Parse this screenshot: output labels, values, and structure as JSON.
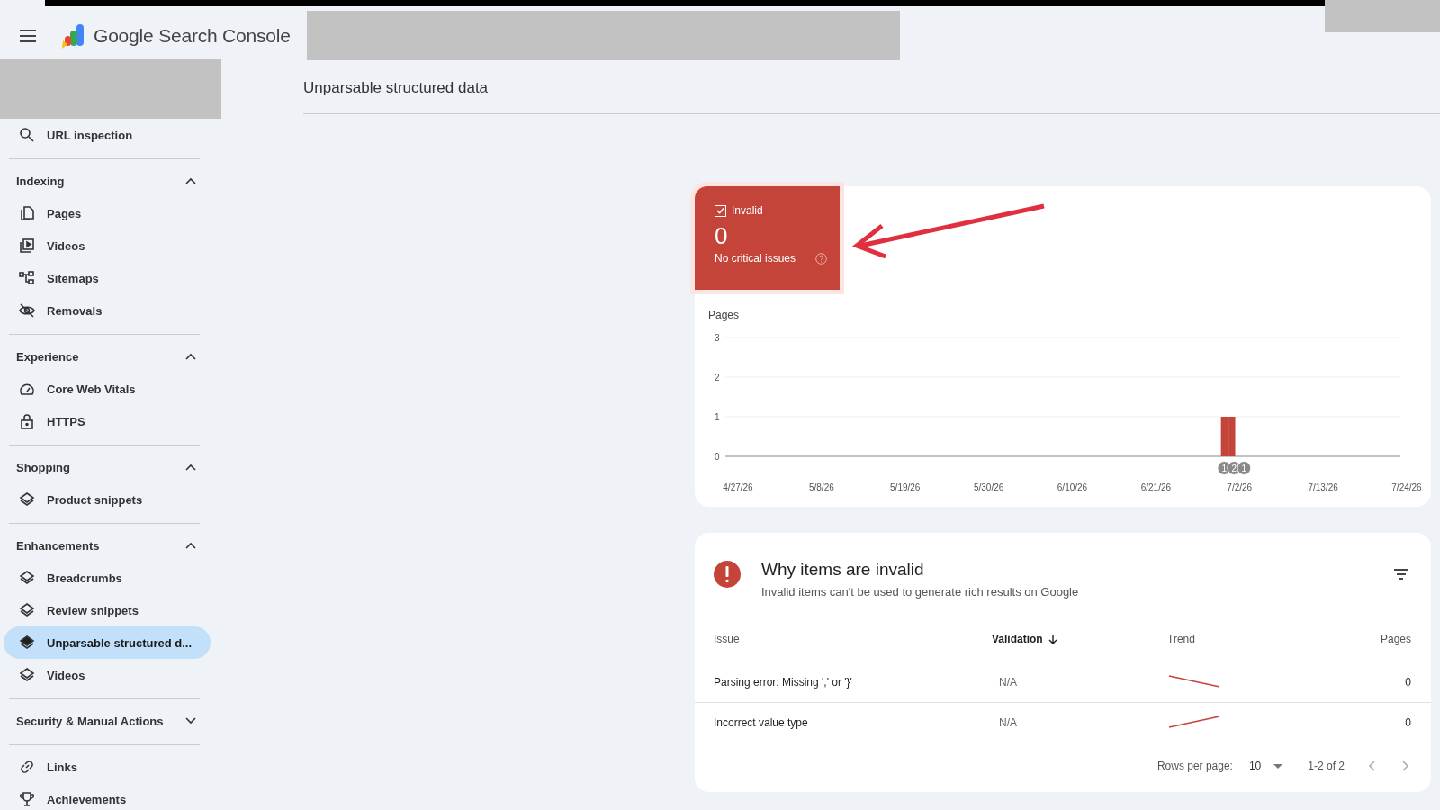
{
  "app": {
    "title": "Google Search Console"
  },
  "sidebar": {
    "groups": [
      {
        "items": [
          {
            "label": "URL inspection",
            "selected": false
          }
        ]
      },
      {
        "title": "Indexing",
        "expanded": true,
        "items": [
          {
            "label": "Pages",
            "selected": false
          },
          {
            "label": "Videos",
            "selected": false
          },
          {
            "label": "Sitemaps",
            "selected": false
          },
          {
            "label": "Removals",
            "selected": false
          }
        ]
      },
      {
        "title": "Experience",
        "expanded": true,
        "items": [
          {
            "label": "Core Web Vitals",
            "selected": false
          },
          {
            "label": "HTTPS",
            "selected": false
          }
        ]
      },
      {
        "title": "Shopping",
        "expanded": true,
        "items": [
          {
            "label": "Product snippets",
            "selected": false
          }
        ]
      },
      {
        "title": "Enhancements",
        "expanded": true,
        "items": [
          {
            "label": "Breadcrumbs",
            "selected": false
          },
          {
            "label": "Review snippets",
            "selected": false
          },
          {
            "label": "Unparsable structured d...",
            "selected": true
          },
          {
            "label": "Videos",
            "selected": false
          }
        ]
      },
      {
        "title": "Security & Manual Actions",
        "expanded": false
      },
      {
        "items": [
          {
            "label": "Links",
            "selected": false
          },
          {
            "label": "Achievements",
            "selected": false
          }
        ]
      }
    ]
  },
  "page": {
    "title": "Unparsable structured data"
  },
  "status_tile": {
    "label": "Invalid",
    "checked": true,
    "count": "0",
    "note": "No critical issues"
  },
  "chart": {
    "chart_data": {
      "type": "bar",
      "ylabel": "Pages",
      "categories": [
        "4/27/26",
        null,
        null,
        null,
        null,
        null,
        null,
        null,
        null,
        null,
        null,
        "5/8/26",
        null,
        null,
        null,
        null,
        null,
        null,
        null,
        null,
        null,
        null,
        "5/19/26",
        null,
        null,
        null,
        null,
        null,
        null,
        null,
        null,
        null,
        null,
        "5/30/26",
        null,
        null,
        null,
        null,
        null,
        null,
        null,
        null,
        null,
        null,
        "6/10/26",
        null,
        null,
        null,
        null,
        null,
        null,
        null,
        null,
        null,
        null,
        "6/21/26",
        null,
        null,
        null,
        null,
        null,
        null,
        null,
        null,
        null,
        null,
        "7/2/26",
        null,
        null,
        null,
        null,
        null,
        null,
        null,
        null,
        null,
        null,
        "7/13/26",
        null,
        null,
        null,
        null,
        null,
        null,
        null,
        null,
        null,
        null,
        "7/24/26"
      ],
      "series": [
        {
          "color": "#c5443a",
          "values": [
            null,
            null,
            null,
            null,
            null,
            null,
            null,
            null,
            null,
            null,
            null,
            null,
            null,
            null,
            null,
            null,
            null,
            null,
            null,
            null,
            null,
            null,
            null,
            null,
            null,
            null,
            null,
            null,
            null,
            null,
            null,
            null,
            null,
            null,
            null,
            null,
            null,
            null,
            null,
            null,
            null,
            null,
            null,
            null,
            null,
            null,
            null,
            null,
            null,
            null,
            null,
            null,
            null,
            null,
            null,
            null,
            null,
            null,
            null,
            null,
            null,
            null,
            null,
            null,
            1,
            1,
            null,
            null,
            null,
            null,
            null,
            null,
            null,
            null,
            null,
            null,
            null,
            null,
            null,
            null,
            null,
            null,
            null,
            null,
            null,
            null,
            null,
            null,
            null
          ]
        }
      ],
      "ylim": [
        0,
        3
      ],
      "yticks": [
        0,
        1,
        2,
        3
      ],
      "annotations": [
        "1",
        "2",
        "1"
      ]
    }
  },
  "issues": {
    "title": "Why items are invalid",
    "subtitle": "Invalid items can't be used to generate rich results on Google",
    "columns": [
      {
        "label": "Issue",
        "sorted": false
      },
      {
        "label": "Validation",
        "sorted": true
      },
      {
        "label": "Trend",
        "sorted": false
      },
      {
        "label": "Pages",
        "sorted": false
      }
    ],
    "rows": [
      {
        "issue": "Parsing error: Missing ',' or '}'",
        "validation": "N/A",
        "kind": "falling",
        "pages": "0"
      },
      {
        "issue": "Incorrect value type",
        "validation": "N/A",
        "kind": "rising",
        "pages": "0"
      }
    ],
    "pagination": {
      "rows_label": "Rows per page:",
      "rows_value": "10",
      "range": "1-2 of 2"
    }
  }
}
